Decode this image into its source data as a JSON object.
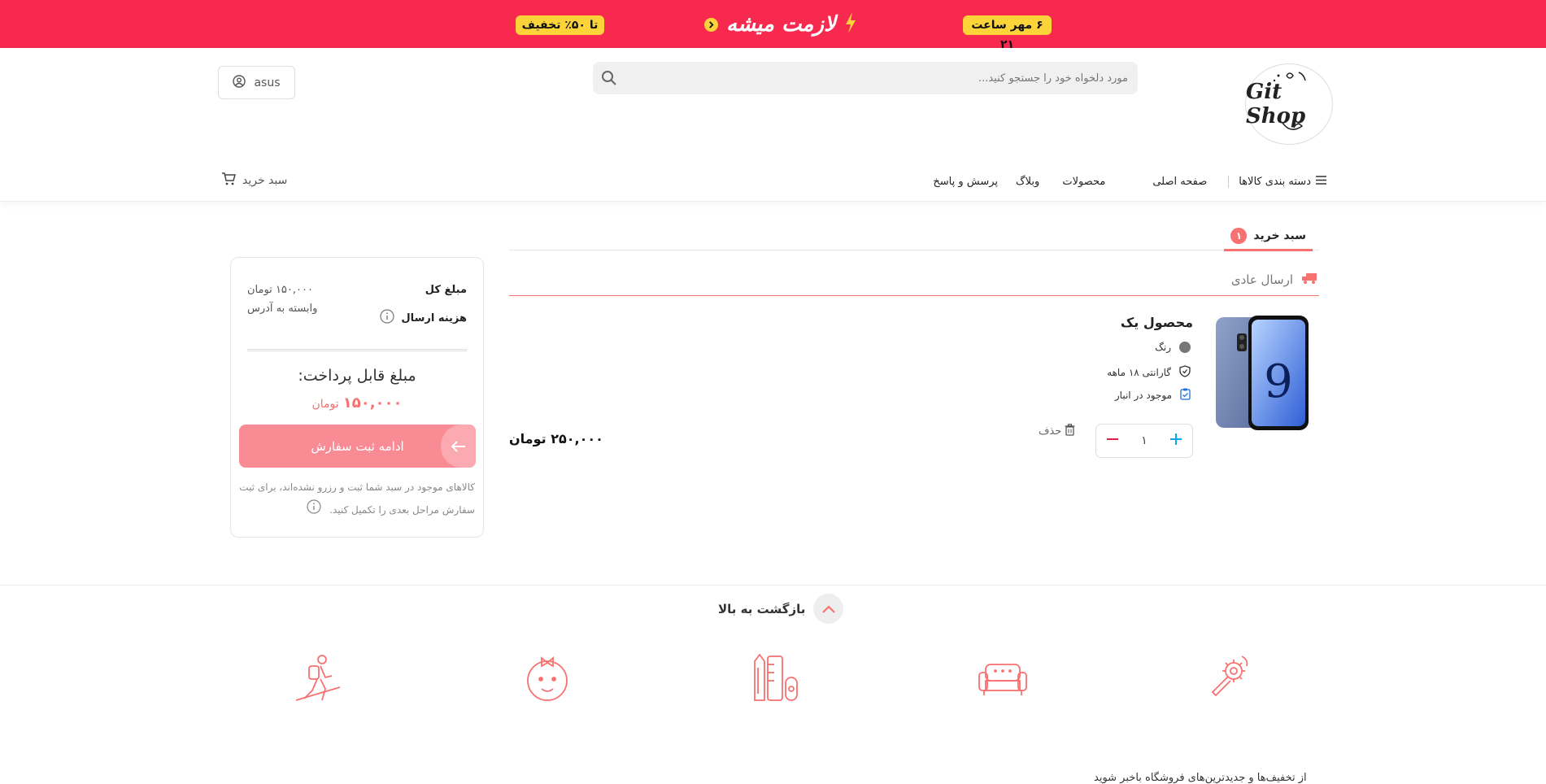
{
  "promo": {
    "discount_badge": "تا ۵۰٪ تخفیف",
    "title": "لازمت میشه",
    "date_badge": "۶ مهر ساعت ۲۱"
  },
  "header": {
    "logo_text": "Git Shop",
    "search_placeholder": "مورد دلخواه خود را جستجو کنید...",
    "user_label": "asus",
    "categories_label": "دسته بندی کالاها",
    "nav_items": [
      "صفحه اصلی",
      "محصولات",
      "وبلاگ",
      "پرسش و پاسخ"
    ],
    "cart_label": "سبد خرید"
  },
  "cart": {
    "tab_label": "سبد خرید",
    "tab_count": "۱",
    "shipping_label": "ارسال عادی",
    "product": {
      "title": "محصول یک",
      "color_label": "رنگ",
      "warranty": "گارانتی ۱۸ ماهه",
      "stock": "موجود در انبار",
      "quantity": "۱",
      "delete_label": "حذف",
      "price": "۲۵۰,۰۰۰ تومان"
    }
  },
  "summary": {
    "total_label": "مبلغ کل",
    "total_value": "۱۵۰,۰۰۰ تومان",
    "shipping_label": "هزینه ارسال",
    "shipping_value": "وابسته به آدرس",
    "payable_label": "مبلغ قابل پرداخت:",
    "payable_amount": "۱۵۰,۰۰۰",
    "payable_unit": "تومان",
    "continue_label": "ادامه ثبت سفارش",
    "notice": "کالاهای موجود در سبد شما ثبت و رزرو نشده‌اند، برای ثبت سفارش مراحل بعدی را تکمیل کنید."
  },
  "footer": {
    "back_to_top": "بازگشت به بالا",
    "category_icons": [
      "hiker-icon",
      "baby-icon",
      "stationery-icon",
      "sofa-icon",
      "tools-icon"
    ],
    "bottom_text": "از تخفیف‌ها و جدیدترین‌های فروشگاه باخبر شوید"
  },
  "colors": {
    "brand": "#f8294f",
    "accent": "#f87171",
    "badge": "#fcd43a"
  }
}
